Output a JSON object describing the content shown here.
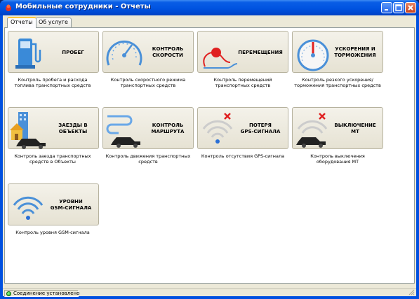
{
  "window": {
    "title": "Мобильные сотрудники - Отчеты"
  },
  "tabs": [
    {
      "label": "Отчеты",
      "active": true
    },
    {
      "label": "Об услуге",
      "active": false
    }
  ],
  "tiles": [
    {
      "title": "ПРОБЕГ",
      "caption": "Контроль пробега и расхода\nтоплива транспортных средств",
      "icon": "fuel-pump-icon"
    },
    {
      "title": "КОНТРОЛЬ\nСКОРОСТИ",
      "caption": "Контроль скоростного режима\nтранспортных средств",
      "icon": "speedometer-icon"
    },
    {
      "title": "ПЕРЕМЕЩЕНИЯ",
      "caption": "Контроль перемещений\nтранспортных средств",
      "icon": "route-point-icon"
    },
    {
      "title": "УСКОРЕНИЯ И\nТОРМОЖЕНИЯ",
      "caption": "Контроль резкого ускорения/\nторможения транспортных средств",
      "icon": "gauge-icon"
    },
    {
      "title": "ЗАЕЗДЫ В\nОБЪЕКТЫ",
      "caption": "Контроль заезда транспортных\nсредств в Объекты",
      "icon": "building-car-icon"
    },
    {
      "title": "КОНТРОЛЬ\nМАРШРУТА",
      "caption": "Контроль движения транспортных\nсредств",
      "icon": "route-car-icon"
    },
    {
      "title": "ПОТЕРЯ\nGPS-СИГНАЛА",
      "caption": "Контроль отсутствия GPS-сигнала",
      "icon": "gps-lost-icon"
    },
    {
      "title": "ВЫКЛЮЧЕНИЕ МТ",
      "caption": "Контроль выключения\nоборудования МТ",
      "icon": "device-off-icon"
    },
    {
      "title": "УРОВНИ\nGSM-СИГНАЛА",
      "caption": "Контроль уровня GSM-сигнала",
      "icon": "gsm-signal-icon"
    }
  ],
  "status": {
    "text": "Соединение установлено",
    "color": "#18a018"
  },
  "colors": {
    "titlebar": "#0053e0",
    "accent_blue": "#2a6fd6",
    "red": "#e02020"
  }
}
